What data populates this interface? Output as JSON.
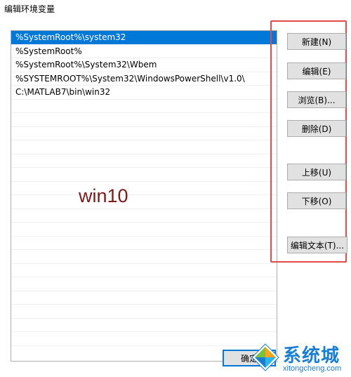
{
  "window": {
    "title": "编辑环境变量"
  },
  "list": {
    "items": [
      {
        "text": "%SystemRoot%\\system32",
        "selected": true
      },
      {
        "text": "%SystemRoot%",
        "selected": false
      },
      {
        "text": "%SystemRoot%\\System32\\Wbem",
        "selected": false
      },
      {
        "text": "%SYSTEMROOT%\\System32\\WindowsPowerShell\\v1.0\\",
        "selected": false
      },
      {
        "text": "C:\\MATLAB7\\bin\\win32",
        "selected": false
      }
    ],
    "empty_rows": 18
  },
  "annotation": {
    "text": "win10",
    "color": "#7b1b1b"
  },
  "buttons": {
    "new": "新建(N)",
    "edit": "编辑(E)",
    "browse": "浏览(B)...",
    "delete": "删除(D)",
    "move_up": "上移(U)",
    "move_down": "下移(O)",
    "edit_text": "编辑文本(T)..."
  },
  "footer": {
    "ok": "确定"
  },
  "watermark": {
    "brand": "系统城",
    "url": "xitongcheng.com"
  },
  "colors": {
    "selection": "#0078d7",
    "highlight_box": "#e34b4b",
    "watermark": "#1a7fd1"
  }
}
